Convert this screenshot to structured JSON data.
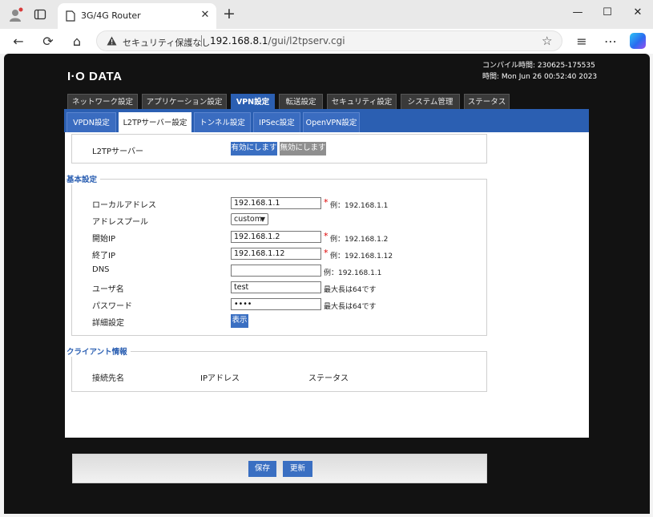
{
  "browser": {
    "tab_title": "3G/4G Router",
    "tab_close": "✕",
    "new_tab": "+",
    "window": {
      "minimize": "—",
      "maximize": "☐",
      "close": "✕"
    },
    "nav": {
      "back": "←",
      "refresh": "⟳",
      "home": "⌂",
      "star": "☆",
      "favorites": "≡",
      "menu": "⋯"
    },
    "security_label": "セキュリティ保護なし",
    "url_host": "192.168.8.1",
    "url_path": "/gui/l2tpserv.cgi"
  },
  "header": {
    "logo": "I·O DATA",
    "compile_time": "コンパイル時間: 230625-175535",
    "current_time": "時間: Mon Jun 26 00:52:40 2023"
  },
  "main_tabs": [
    {
      "label": "ネットワーク設定"
    },
    {
      "label": "アプリケーション設定"
    },
    {
      "label": "VPN設定"
    },
    {
      "label": "転送設定"
    },
    {
      "label": "セキュリティ設定"
    },
    {
      "label": "システム管理"
    },
    {
      "label": "ステータス"
    }
  ],
  "sub_tabs": [
    {
      "label": "VPDN設定"
    },
    {
      "label": "L2TPサーバー設定"
    },
    {
      "label": "トンネル設定"
    },
    {
      "label": "IPSec設定"
    },
    {
      "label": "OpenVPN設定"
    }
  ],
  "l2tp_server": {
    "label": "L2TPサーバー",
    "enable": "有効にします",
    "disable": "無効にします"
  },
  "basic": {
    "legend": "基本設定",
    "local_address": {
      "label": "ローカルアドレス",
      "value": "192.168.1.1",
      "required": "*",
      "hint": "例：192.168.1.1"
    },
    "address_pool": {
      "label": "アドレスプール",
      "value": "custom"
    },
    "start_ip": {
      "label": "開始IP",
      "value": "192.168.1.2",
      "required": "*",
      "hint": "例：192.168.1.2"
    },
    "end_ip": {
      "label": "終了IP",
      "value": "192.168.1.12",
      "required": "*",
      "hint": "例：192.168.1.12"
    },
    "dns": {
      "label": "DNS",
      "value": "",
      "hint": "例：192.168.1.1"
    },
    "username": {
      "label": "ユーザ名",
      "value": "test",
      "hint": "最大長は64です"
    },
    "password": {
      "label": "パスワード",
      "value": "••••",
      "hint": "最大長は64です"
    },
    "advanced": {
      "label": "詳細設定",
      "button": "表示"
    }
  },
  "client": {
    "legend": "クライアント情報",
    "columns": [
      "接続先名",
      "IPアドレス",
      "ステータス"
    ]
  },
  "actions": {
    "save": "保存",
    "update": "更新"
  }
}
